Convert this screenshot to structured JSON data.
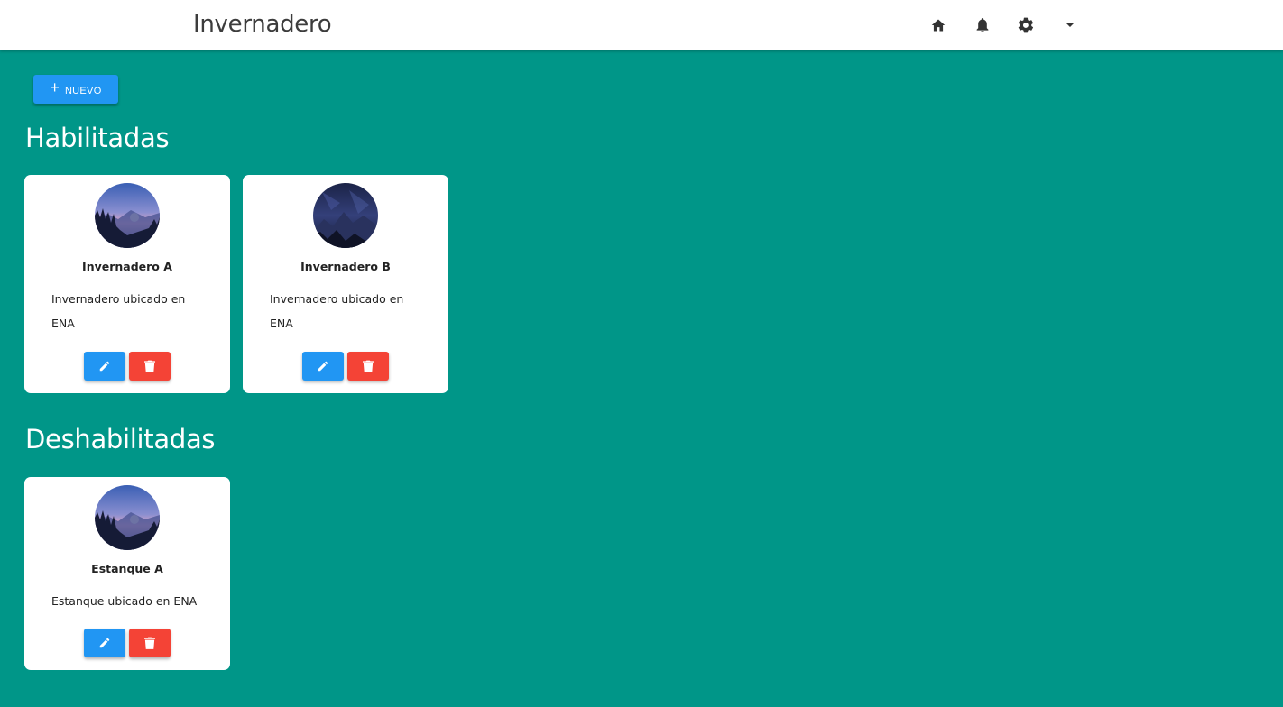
{
  "header": {
    "title": "Invernadero",
    "icons": [
      "home-icon",
      "bell-icon",
      "gear-icon",
      "caret-down-icon"
    ]
  },
  "toolbar": {
    "new_label": "NUEVO"
  },
  "sections": {
    "enabled": {
      "title": "Habilitadas",
      "cards": [
        {
          "name": "Invernadero A",
          "description": "Invernadero ubicado en ENA",
          "avatar": "mountain-dusk"
        },
        {
          "name": "Invernadero B",
          "description": "Invernadero ubicado en ENA",
          "avatar": "dark-mountain-night"
        }
      ]
    },
    "disabled": {
      "title": "Deshabilitadas",
      "cards": [
        {
          "name": "Estanque A",
          "description": "Estanque ubicado en ENA",
          "avatar": "mountain-dusk"
        }
      ]
    }
  },
  "colors": {
    "background": "#009688",
    "primary": "#2196f3",
    "danger": "#f44336",
    "header": "#ffffff"
  }
}
